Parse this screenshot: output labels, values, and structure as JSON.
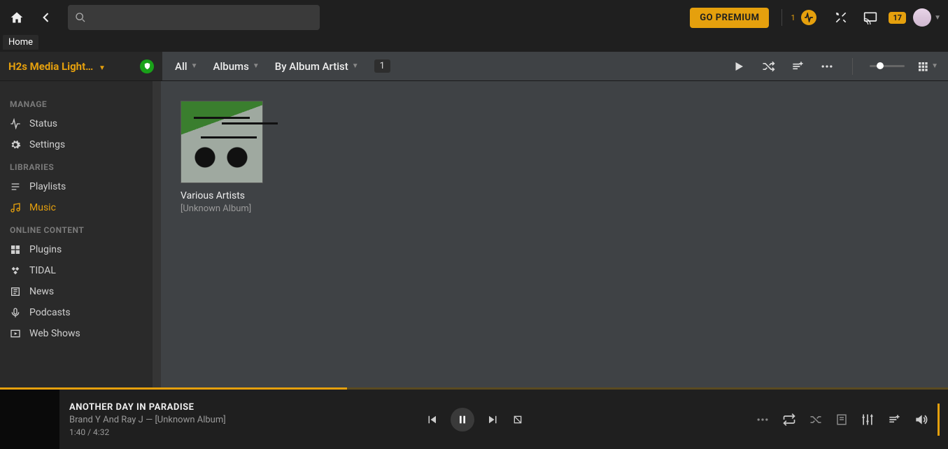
{
  "topbar": {
    "go_premium": "GO PREMIUM",
    "activity_count": "1",
    "alerts": "17"
  },
  "breadcrumb": "Home",
  "library": {
    "title": "H2s Media Light…"
  },
  "filters": {
    "all": "All",
    "albums": "Albums",
    "by": "By Album Artist",
    "count": "1"
  },
  "sidebar": {
    "manage": "MANAGE",
    "status": "Status",
    "settings": "Settings",
    "libraries": "LIBRARIES",
    "playlists": "Playlists",
    "music": "Music",
    "online": "ONLINE CONTENT",
    "plugins": "Plugins",
    "tidal": "TIDAL",
    "news": "News",
    "podcasts": "Podcasts",
    "webshows": "Web Shows"
  },
  "grid": {
    "card_title": "Various Artists",
    "card_sub": "[Unknown Album]"
  },
  "player": {
    "title": "ANOTHER DAY IN PARADISE",
    "artist_line": "Brand Y And Ray J — [Unknown Album]",
    "time": "1:40 / 4:32"
  }
}
